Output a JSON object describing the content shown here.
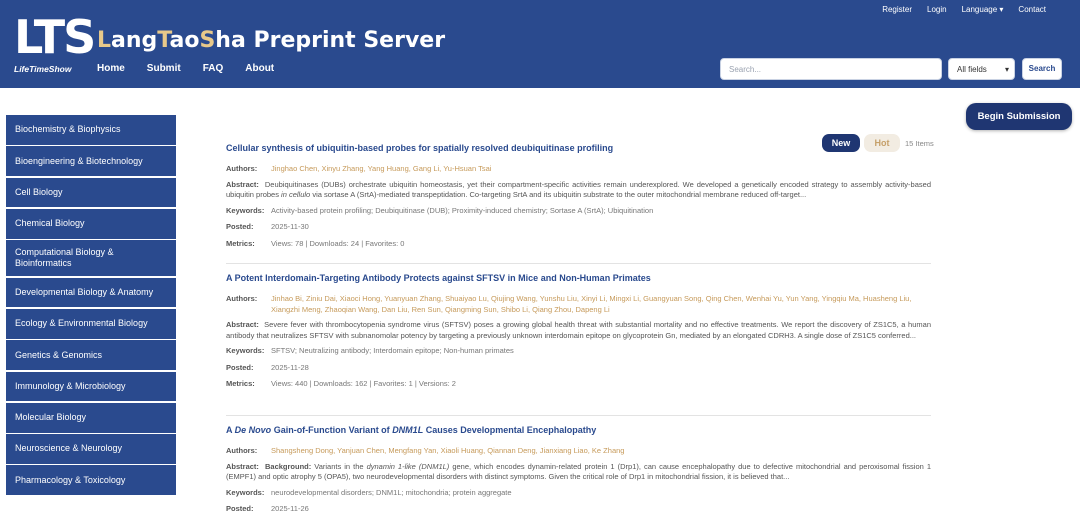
{
  "header": {
    "logo_letters": "LTS",
    "logo_sub": "LifeTimeShow",
    "title_parts": [
      {
        "t": "L",
        "hl": true
      },
      {
        "t": "ang",
        "hl": false
      },
      {
        "t": "T",
        "hl": true
      },
      {
        "t": "ao",
        "hl": false
      },
      {
        "t": "S",
        "hl": true
      },
      {
        "t": "ha Preprint Server",
        "hl": false
      }
    ],
    "nav": [
      "Home",
      "Submit",
      "FAQ",
      "About"
    ],
    "top_links": [
      "Register",
      "Login",
      "Language ▾",
      "Contact"
    ],
    "search_placeholder": "Search...",
    "field_select": "All fields",
    "search_button": "Search"
  },
  "sidebar": {
    "items": [
      {
        "label": "Biochemistry & Biophysics"
      },
      {
        "label": "Bioengineering & Biotechnology"
      },
      {
        "label": "Cell Biology"
      },
      {
        "label": "Chemical Biology"
      },
      {
        "label": "Computational Biology & Bioinformatics"
      },
      {
        "label": "Developmental Biology & Anatomy"
      },
      {
        "label": "Ecology & Environmental Biology"
      },
      {
        "label": "Genetics & Genomics"
      },
      {
        "label": "Immunology & Microbiology"
      },
      {
        "label": "Molecular Biology"
      },
      {
        "label": "Neuroscience & Neurology"
      },
      {
        "label": "Pharmacology & Toxicology"
      }
    ]
  },
  "main": {
    "begin_button": "Begin Submission",
    "sort_new": "New",
    "sort_hot": "Hot",
    "items_count": "15 Items",
    "labels": {
      "authors": "Authors:",
      "abstract": "Abstract:",
      "keywords": "Keywords:",
      "posted": "Posted:",
      "metrics": "Metrics:"
    },
    "articles": [
      {
        "title": "Cellular synthesis of ubiquitin-based probes for spatially resolved deubiquitinase profiling",
        "authors": "Jinghao Chen, Xinyu Zhang, Yang Huang, Gang Li, Yu-Hsuan Tsai",
        "abstract_pre": "Deubiquitinases (DUBs) orchestrate ubiquitin homeostasis, yet their compartment-specific activities remain underexplored. We developed a genetically encoded strategy to assembly activity-based ubiquitin probes ",
        "abstract_em": "in cellulo",
        "abstract_post": " via sortase A (SrtA)-mediated transpeptidation. Co-targeting SrtA and its ubiquitin substrate to the outer mitochondrial membrane reduced off-target...",
        "keywords": "Activity-based protein profiling; Deubiquitinase (DUB); Proximity-induced chemistry; Sortase A (SrtA); Ubiquitination",
        "posted": "2025-11-30",
        "metrics": "Views: 78 | Downloads: 24 | Favorites: 0"
      },
      {
        "title": "A Potent Interdomain-Targeting Antibody Protects against SFTSV in Mice and Non-Human Primates",
        "authors": "Jinhao Bi, Ziniu Dai, Xiaoci Hong, Yuanyuan Zhang, Shuaiyao Lu, Qiujing Wang, Yunshu Liu, Xinyi Li, Mingxi Li, Guangyuan Song, Qing Chen, Wenhai Yu, Yun Yang, Yingqiu Ma, Huasheng Liu, Xiangzhi Meng, Zhaoqian Wang, Dan Liu, Ren Sun, Qiangming Sun, Shibo Li, Qiang Zhou, Dapeng Li",
        "abstract_text": "Severe fever with thrombocytopenia syndrome virus (SFTSV) poses a growing global health threat with substantial mortality and no effective treatments. We report the discovery of ZS1C5, a human antibody that neutralizes SFTSV with subnanomolar potency by targeting a previously unknown interdomain epitope on glycoprotein Gn, mediated by an elongated CDRH3. A single dose of ZS1C5 conferred...",
        "keywords": "SFTSV; Neutralizing antibody; Interdomain epitope; Non-human primates",
        "posted": "2025-11-28",
        "metrics": "Views: 440 | Downloads: 162 | Favorites: 1 | Versions: 2"
      },
      {
        "title_pre": "A ",
        "title_em1": "De Novo",
        "title_mid": " Gain-of-Function Variant of ",
        "title_em2": "DNM1L",
        "title_post": " Causes Developmental Encephalopathy",
        "authors": "Shangsheng Dong, Yanjuan Chen, Mengfang Yan, Xiaoli Huang, Qiannan Deng, Jianxiang Liao, Ke Zhang",
        "abstract_bold": "Background:",
        "abstract_a": " Variants in the ",
        "abstract_em1": "dynamin 1-like (DNM1L)",
        "abstract_b": " gene, which encodes dynamin-related protein 1 (Drp1), can cause encephalopathy due to defective mitochondrial and peroxisomal fission 1 (EMPF1) and optic atrophy 5 (OPA5), two neurodevelopmental disorders with distinct symptoms. Given the critical role of Drp1 in mitochondrial fission, it is believed that...",
        "keywords": "neurodevelopmental disorders; DNM1L; mitochondria; protein aggregate",
        "posted": "2025-11-26"
      }
    ]
  }
}
